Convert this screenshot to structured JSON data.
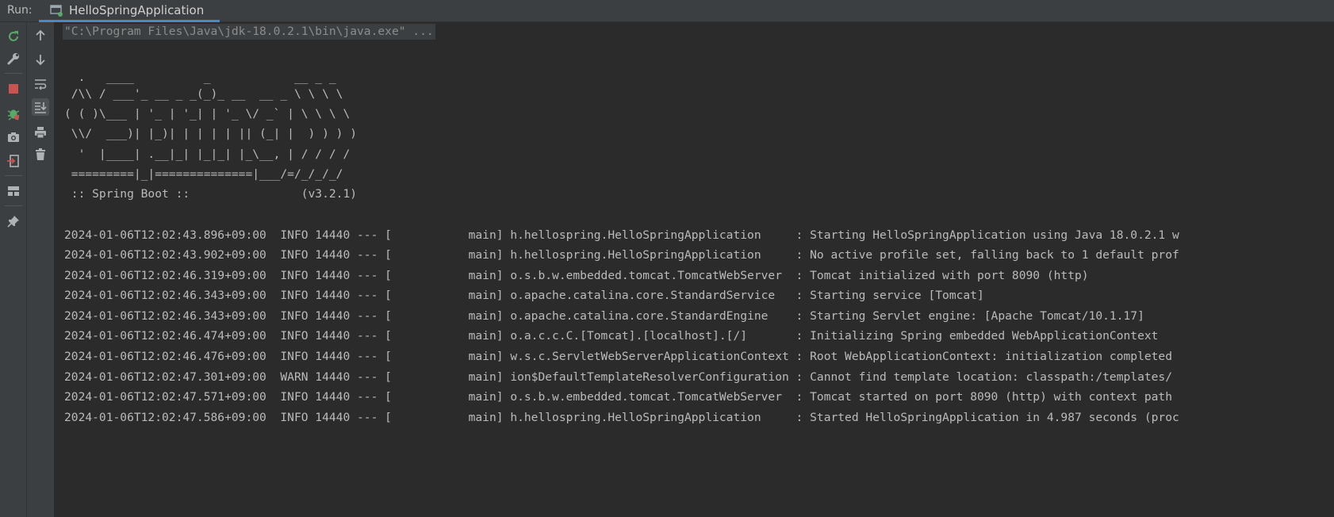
{
  "toolbar": {
    "run_label": "Run:",
    "tab_label": "HelloSpringApplication"
  },
  "left_tools": [
    "rerun-icon",
    "wrench-icon",
    "stop-icon",
    "debug-icon",
    "camera-icon",
    "login-icon",
    "layout-icon",
    "pin-icon"
  ],
  "right_tools": [
    "arrow-up-icon",
    "arrow-down-icon",
    "soft-wrap-icon",
    "scroll-to-end-icon",
    "print-icon",
    "trash-icon"
  ],
  "console": {
    "command": "\"C:\\Program Files\\Java\\jdk-18.0.2.1\\bin\\java.exe\" ...",
    "banner": [
      "  .   ____          _            __ _ _",
      " /\\\\ / ___'_ __ _ _(_)_ __  __ _ \\ \\ \\ \\",
      "( ( )\\___ | '_ | '_| | '_ \\/ _` | \\ \\ \\ \\",
      " \\\\/  ___)| |_)| | | | | || (_| |  ) ) ) )",
      "  '  |____| .__|_| |_|_| |_\\__, | / / / /",
      " =========|_|==============|___/=/_/_/_/",
      " :: Spring Boot ::                (v3.2.1)"
    ],
    "logs": [
      "2024-01-06T12:02:43.896+09:00  INFO 14440 --- [           main] h.hellospring.HelloSpringApplication     : Starting HelloSpringApplication using Java 18.0.2.1 w",
      "2024-01-06T12:02:43.902+09:00  INFO 14440 --- [           main] h.hellospring.HelloSpringApplication     : No active profile set, falling back to 1 default prof",
      "2024-01-06T12:02:46.319+09:00  INFO 14440 --- [           main] o.s.b.w.embedded.tomcat.TomcatWebServer  : Tomcat initialized with port 8090 (http)",
      "2024-01-06T12:02:46.343+09:00  INFO 14440 --- [           main] o.apache.catalina.core.StandardService   : Starting service [Tomcat]",
      "2024-01-06T12:02:46.343+09:00  INFO 14440 --- [           main] o.apache.catalina.core.StandardEngine    : Starting Servlet engine: [Apache Tomcat/10.1.17]",
      "2024-01-06T12:02:46.474+09:00  INFO 14440 --- [           main] o.a.c.c.C.[Tomcat].[localhost].[/]       : Initializing Spring embedded WebApplicationContext",
      "2024-01-06T12:02:46.476+09:00  INFO 14440 --- [           main] w.s.c.ServletWebServerApplicationContext : Root WebApplicationContext: initialization completed",
      "2024-01-06T12:02:47.301+09:00  WARN 14440 --- [           main] ion$DefaultTemplateResolverConfiguration : Cannot find template location: classpath:/templates/",
      "2024-01-06T12:02:47.571+09:00  INFO 14440 --- [           main] o.s.b.w.embedded.tomcat.TomcatWebServer  : Tomcat started on port 8090 (http) with context path",
      "2024-01-06T12:02:47.586+09:00  INFO 14440 --- [           main] h.hellospring.HelloSpringApplication     : Started HelloSpringApplication in 4.987 seconds (proc"
    ]
  },
  "colors": {
    "panel_bg": "#3c3f41",
    "console_bg": "#2b2b2b",
    "text": "#bbbbbb",
    "accent": "#4a88c7",
    "rerun_green": "#59a869",
    "stop_red": "#c75450"
  }
}
